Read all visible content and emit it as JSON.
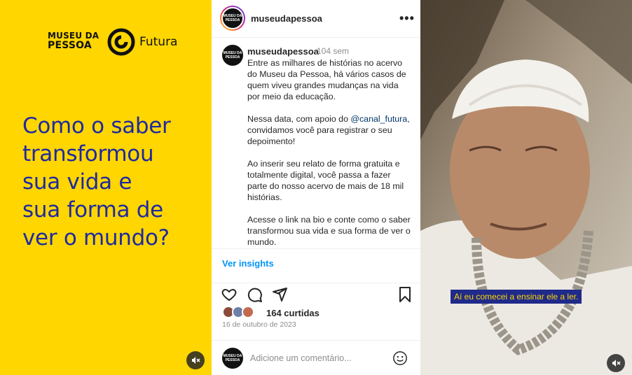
{
  "left_panel": {
    "museu_logo_line1": "MUSEU DA",
    "museu_logo_line2": "PESSOA",
    "futura_logo": "Futura",
    "headline_lines": [
      "Como o saber",
      "transformou",
      "sua vida e",
      "sua forma de",
      "ver o mundo?"
    ],
    "background_color": "#FFD600",
    "headline_color": "#1F2AA0"
  },
  "post": {
    "header_username": "museudapessoa",
    "avatar_text": "MUSEU DA PESSOA",
    "caption_username": "museudapessoa",
    "caption_time": "104 sem",
    "caption_paragraphs": [
      "Entre as milhares de histórias no acervo do Museu da Pessoa, há vários casos de quem viveu grandes mudanças na vida por meio da educação.",
      "Ao inserir seu relato de forma gratuita e totalmente digital, você passa a fazer parte do nosso acervo de mais de 18 mil histórias.",
      "Acesse o link na bio e conte como o saber transformou sua vida e sua forma de ver o mundo."
    ],
    "caption_p2_before": "Nessa data, com apoio do ",
    "caption_p2_mention": "@canal_futura",
    "caption_p2_after": ", convidamos você para registrar o seu depoimento!",
    "insights_label": "Ver insights",
    "likes_text": "164 curtidas",
    "date": "16 de outubro de 2023",
    "comment_placeholder": "Adicione um comentário...",
    "link_color": "#0095f6"
  },
  "video": {
    "subtitle": "Aí eu comecei a ensinar ele a ler.",
    "subtitle_bg": "#1f2a8a",
    "subtitle_color": "#FFD600"
  },
  "icons": [
    "mute-icon",
    "more-icon",
    "heart-icon",
    "comment-icon",
    "share-icon",
    "bookmark-icon",
    "emoji-icon"
  ]
}
